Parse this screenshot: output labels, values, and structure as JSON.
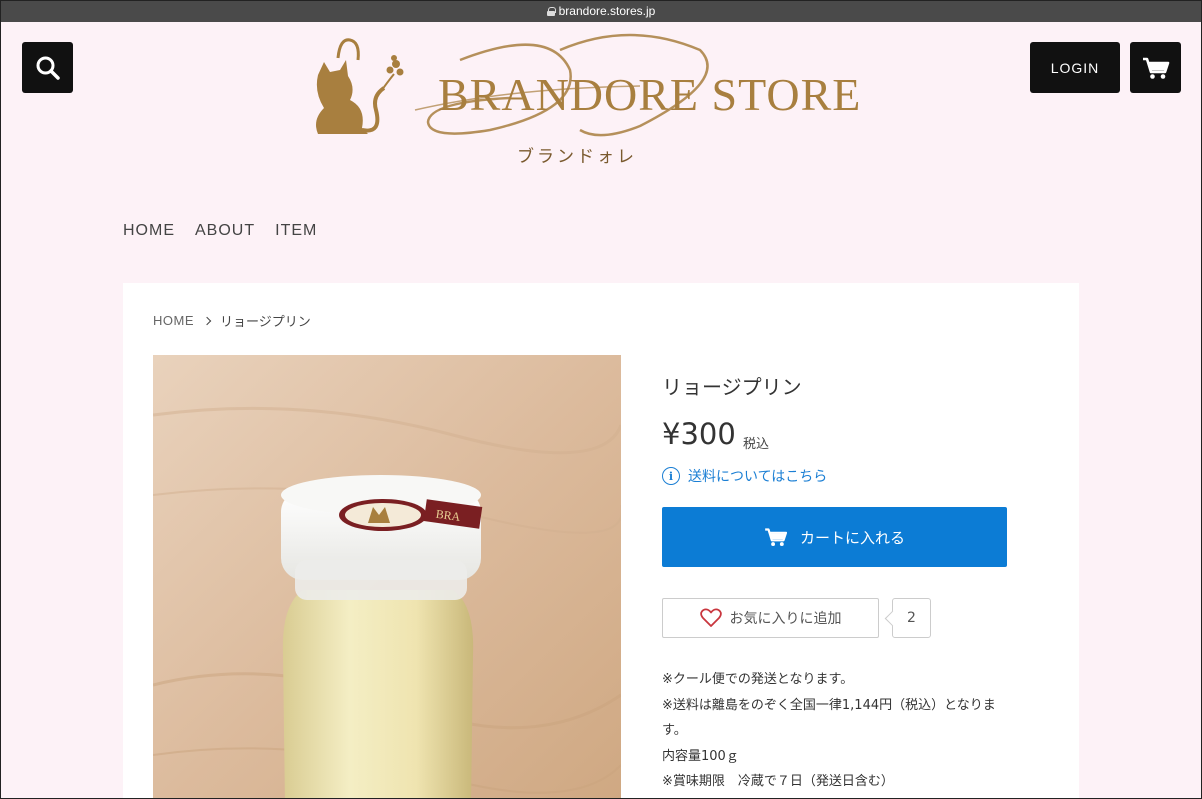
{
  "browser": {
    "url": "brandore.stores.jp"
  },
  "header": {
    "login_label": "LOGIN",
    "logo_text": "BRANDORE STORE",
    "logo_subtext": "ブランドォレ"
  },
  "nav": {
    "items": [
      {
        "label": "HOME"
      },
      {
        "label": "ABOUT"
      },
      {
        "label": "ITEM"
      }
    ]
  },
  "breadcrumb": {
    "home": "HOME",
    "current": "リョージプリン"
  },
  "product": {
    "title": "リョージプリン",
    "price": "¥300",
    "tax_label": "税込",
    "shipping_link": "送料についてはこちら",
    "add_to_cart_label": "カートに入れる",
    "favorite_label": "お気に入りに追加",
    "favorite_count": "2",
    "image_label": "BRA",
    "description": [
      "※クール便での発送となります。",
      "※送料は離島をのぞく全国一律1,144円（税込）となりま",
      "す。",
      "内容量100ｇ",
      "※賞味期限　冷蔵で７日（発送日含む）"
    ]
  },
  "colors": {
    "page_background": "#fdf2f7",
    "brand_gold": "#a87f3f",
    "cart_button": "#0c7cd5",
    "link_blue": "#1b7fd4"
  },
  "icons": [
    "lock-icon",
    "search-icon",
    "cart-icon",
    "info-icon",
    "heart-icon",
    "chevron-right-icon",
    "cat-logo-icon"
  ]
}
